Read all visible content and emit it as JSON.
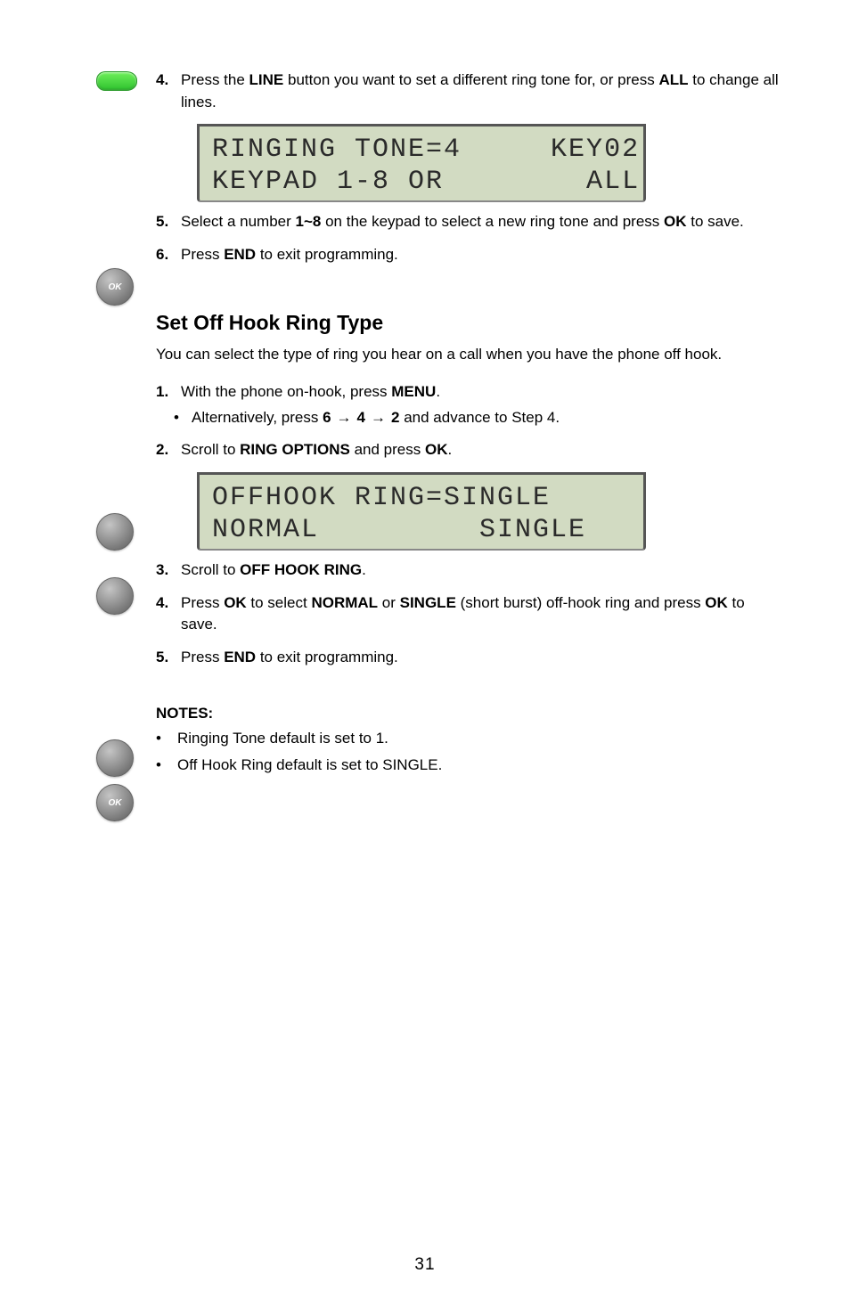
{
  "step4": {
    "num": "4.",
    "text_a": "Press the ",
    "text_b": " button you want to set a different ring tone for, or press ",
    "softkey": "ALL",
    "text_c": " to change all lines."
  },
  "lcd1": {
    "line1": "RINGING TONE=4     KEY02",
    "line2": "KEYPAD 1-8 OR        ALL"
  },
  "step5": {
    "num": "5.",
    "text_a": "Select a number ",
    "range": "1~8",
    "text_b": " on the keypad to select a new ring tone and press ",
    "ok": "OK",
    "text_c": " to save."
  },
  "step6": {
    "num": "6.",
    "text_a": "Press ",
    "end": "END",
    "text_b": " to exit programming."
  },
  "section2": {
    "title": "Set Off Hook Ring Type",
    "intro": "You can select the type of ring you hear on a call when you have the phone off hook.",
    "step1": {
      "num": "1.",
      "text_a": "With the phone on-hook, press ",
      "btn": "MENU",
      "text_b": ".",
      "bullet_text": "Alternatively, press ",
      "seq_a": "6",
      "seq_b": "4",
      "seq_c": "2",
      "tail": " and advance to Step 4."
    },
    "step2": {
      "num": "2.",
      "text_a": "Scroll to ",
      "label": "RING OPTIONS",
      "text_b": " and press ",
      "ok": "OK",
      "tail": "."
    },
    "lcd2": {
      "line1": "OFFHOOK RING=SINGLE",
      "line2": "NORMAL         SINGLE"
    },
    "step3": {
      "num": "3.",
      "text_a": "Scroll to ",
      "label": "OFF HOOK RING",
      "text_b": "."
    },
    "step4": {
      "num": "4.",
      "text_a": "Press ",
      "ok": "OK",
      "text_b": " to select ",
      "opt1": "NORMAL",
      "or": " or ",
      "opt2": "SINGLE",
      "sub": " (short burst)",
      "text_c": " off-hook ring and press ",
      "ok2": "OK",
      "text_d": " to save."
    },
    "step5": {
      "num": "5.",
      "text_a": "Press ",
      "end": "END",
      "text_b": " to exit programming."
    }
  },
  "notes": {
    "head": "NOTES:",
    "n1": "Ringing Tone default is set to 1.",
    "n2": "Off Hook Ring default is set to SINGLE."
  },
  "footer": "31"
}
